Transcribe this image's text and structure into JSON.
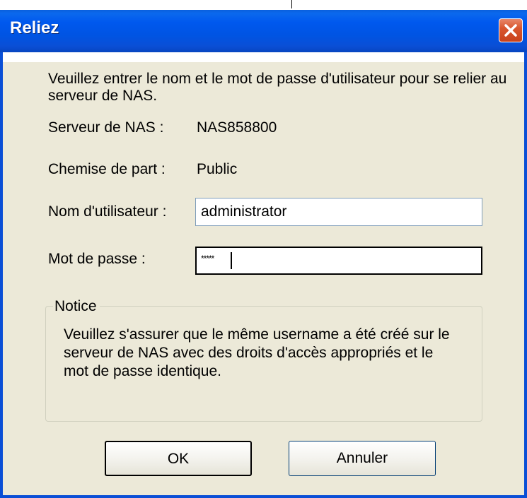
{
  "window": {
    "title": "Reliez",
    "close_icon": "close-x-icon"
  },
  "dialog": {
    "intro": "Veuillez entrer le nom et le mot de passe d'utilisateur pour se relier au serveur de NAS.",
    "server_label": "Serveur de NAS :",
    "server_value": "NAS858800",
    "share_label": "Chemise de part :",
    "share_value": "Public",
    "username_label": "Nom d'utilisateur :",
    "username_value": "administrator",
    "password_label": "Mot de passe :",
    "password_value": "*****"
  },
  "notice": {
    "title": "Notice",
    "text": "Veuillez s'assurer que le même username a été créé sur le serveur de NAS avec des droits d'accès appropriés et le mot de passe identique."
  },
  "buttons": {
    "ok_label": "OK",
    "cancel_label": "Annuler"
  },
  "colors": {
    "titlebar": "#0054e3",
    "dialog_bg": "#ece9d8",
    "close_button": "#d9572f"
  }
}
